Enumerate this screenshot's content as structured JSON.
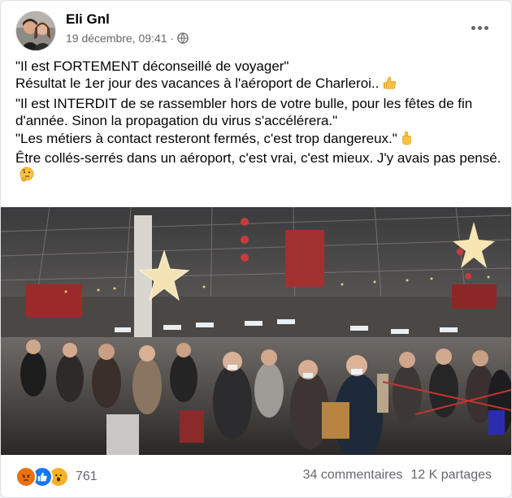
{
  "post": {
    "author": "Eli Gnl",
    "date": "19 décembre, 09:41",
    "separator": "·",
    "privacy_icon": "globe-icon",
    "more_icon": "more-options-icon",
    "lines": [
      "\"Il est FORTEMENT déconseillé de voyager\"",
      "Résultat le 1er jour des vacances à l'aéroport de Charleroi..",
      "\"Il est INTERDIT de se rassembler hors de votre bulle, pour les fêtes de fin d'année. Sinon la propagation du virus s'accélérera.\"",
      "\"Les métiers à contact resteront fermés, c'est trop dangereux.\"",
      "Être collés-serrés dans un aéroport, c'est vrai, c'est mieux. J'y avais pas pensé."
    ],
    "emojis": [
      "thumbs-up-emoji",
      "middle-finger-emoji",
      "thinking-face-emoji"
    ]
  },
  "reactions": {
    "icons": [
      "angry-reaction-icon",
      "like-reaction-icon",
      "wow-reaction-icon"
    ],
    "count": "761"
  },
  "stats": {
    "comments": "34 commentaires",
    "shares": "12 K partages"
  },
  "colors": {
    "like_blue": "#1877f2",
    "angry": "#e9710f",
    "wow": "#f7b125",
    "secondary_text": "#65676b"
  }
}
